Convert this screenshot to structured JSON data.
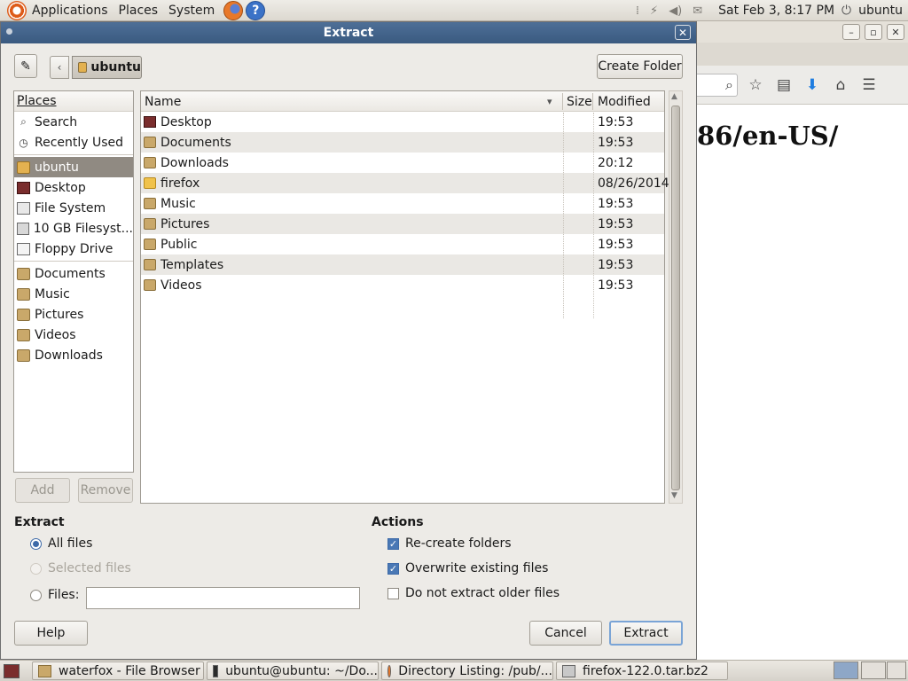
{
  "top_panel": {
    "menus": [
      "Applications",
      "Places",
      "System"
    ],
    "clock": "Sat Feb  3,  8:17 PM",
    "user": "ubuntu"
  },
  "background_window": {
    "url_fragment": "86/en-US/"
  },
  "dialog": {
    "title": "Extract",
    "close_glyph": "✕",
    "path": {
      "back_glyph": "‹",
      "current": "ubuntu"
    },
    "create_folder_label": "Create Folder",
    "places": {
      "header": "Places",
      "items": [
        {
          "label": "Search",
          "icon": "search-icon"
        },
        {
          "label": "Recently Used",
          "icon": "clock-icon"
        },
        {
          "label": "ubuntu",
          "icon": "home-folder-icon",
          "selected": true
        },
        {
          "label": "Desktop",
          "icon": "desktop-icon"
        },
        {
          "label": "File System",
          "icon": "filesystem-icon"
        },
        {
          "label": "10 GB Filesyst...",
          "icon": "disk-icon"
        },
        {
          "label": "Floppy Drive",
          "icon": "floppy-icon"
        },
        {
          "label": "Documents",
          "icon": "folder-icon"
        },
        {
          "label": "Music",
          "icon": "folder-icon"
        },
        {
          "label": "Pictures",
          "icon": "folder-icon"
        },
        {
          "label": "Videos",
          "icon": "folder-icon"
        },
        {
          "label": "Downloads",
          "icon": "folder-icon"
        }
      ],
      "add_label": "Add",
      "remove_label": "Remove"
    },
    "files": {
      "columns": {
        "name": "Name",
        "size": "Size",
        "modified": "Modified"
      },
      "rows": [
        {
          "name": "Desktop",
          "size": "",
          "modified": "19:53"
        },
        {
          "name": "Documents",
          "size": "",
          "modified": "19:53"
        },
        {
          "name": "Downloads",
          "size": "",
          "modified": "20:12"
        },
        {
          "name": "firefox",
          "size": "",
          "modified": "08/26/2014"
        },
        {
          "name": "Music",
          "size": "",
          "modified": "19:53"
        },
        {
          "name": "Pictures",
          "size": "",
          "modified": "19:53"
        },
        {
          "name": "Public",
          "size": "",
          "modified": "19:53"
        },
        {
          "name": "Templates",
          "size": "",
          "modified": "19:53"
        },
        {
          "name": "Videos",
          "size": "",
          "modified": "19:53"
        }
      ]
    },
    "extract_section": {
      "title": "Extract",
      "all_files": "All files",
      "selected_files": "Selected files",
      "files_label": "Files:",
      "files_value": ""
    },
    "actions_section": {
      "title": "Actions",
      "recreate_folders": "Re-create folders",
      "overwrite_existing": "Overwrite existing files",
      "do_not_extract_older": "Do not extract older files"
    },
    "help_label": "Help",
    "cancel_label": "Cancel",
    "extract_label": "Extract"
  },
  "taskbar": {
    "tasks": [
      "waterfox - File Browser",
      "ubuntu@ubuntu: ~/Do...",
      "Directory Listing: /pub/...",
      "firefox-122.0.tar.bz2"
    ]
  }
}
